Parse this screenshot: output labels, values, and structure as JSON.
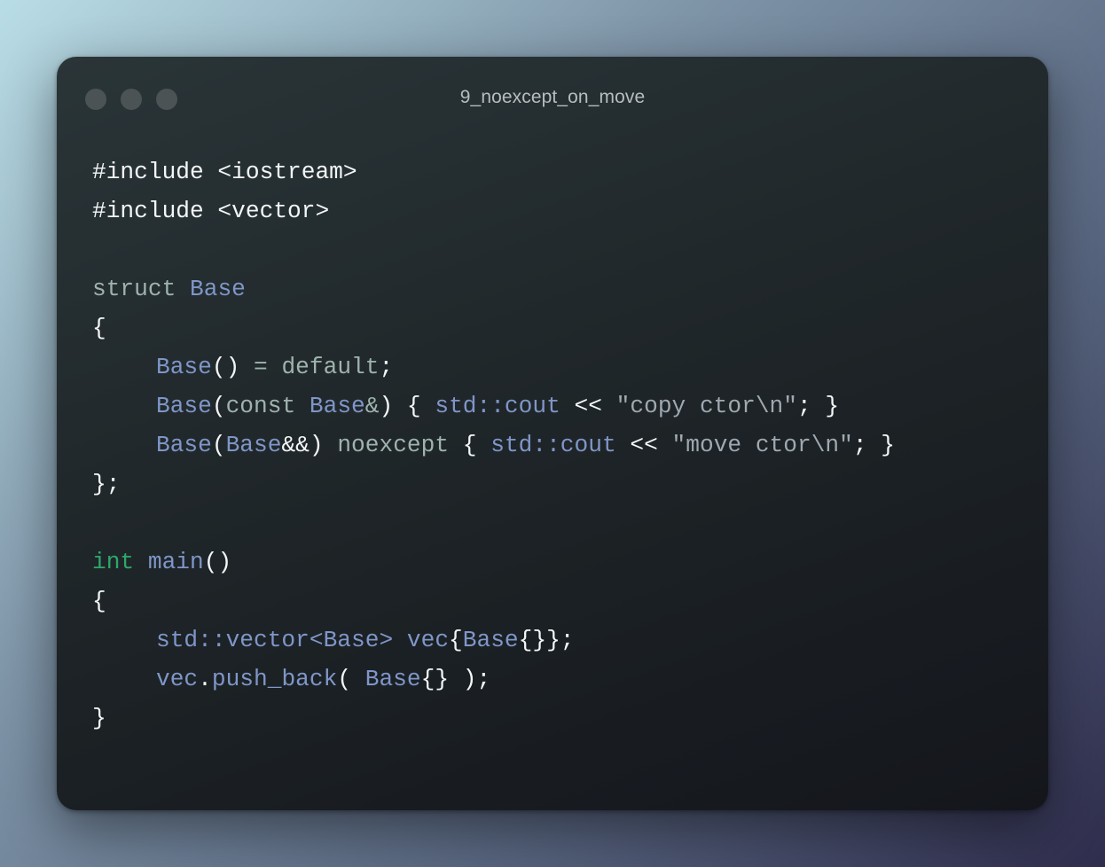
{
  "window": {
    "title": "9_noexcept_on_move",
    "controls": [
      "close",
      "minimize",
      "maximize"
    ]
  },
  "colors": {
    "plain": "#f3f6f6",
    "keyword": "#9fb3ad",
    "type_keyword": "#2da86a",
    "identifier": "#7f96c8",
    "string": "#9ea9b1",
    "window_control": "#4c5354",
    "title_text": "#b7bcbf"
  },
  "code": {
    "lines": [
      {
        "indent": 0,
        "tokens": [
          {
            "t": "plain",
            "s": "#include <iostream>"
          }
        ]
      },
      {
        "indent": 0,
        "tokens": [
          {
            "t": "plain",
            "s": "#include <vector>"
          }
        ]
      },
      {
        "indent": 0,
        "tokens": []
      },
      {
        "indent": 0,
        "tokens": [
          {
            "t": "kw",
            "s": "struct "
          },
          {
            "t": "ident",
            "s": "Base"
          }
        ]
      },
      {
        "indent": 0,
        "tokens": [
          {
            "t": "plain",
            "s": "{"
          }
        ]
      },
      {
        "indent": 1,
        "tokens": [
          {
            "t": "ident",
            "s": "Base"
          },
          {
            "t": "plain",
            "s": "() "
          },
          {
            "t": "kw",
            "s": "= default"
          },
          {
            "t": "plain",
            "s": ";"
          }
        ]
      },
      {
        "indent": 1,
        "tokens": [
          {
            "t": "ident",
            "s": "Base"
          },
          {
            "t": "plain",
            "s": "("
          },
          {
            "t": "kw",
            "s": "const "
          },
          {
            "t": "ident",
            "s": "Base"
          },
          {
            "t": "kw",
            "s": "&"
          },
          {
            "t": "plain",
            "s": ") { "
          },
          {
            "t": "ident",
            "s": "std::cout"
          },
          {
            "t": "plain",
            "s": " << "
          },
          {
            "t": "str",
            "s": "\"copy ctor\\n\""
          },
          {
            "t": "plain",
            "s": "; }"
          }
        ]
      },
      {
        "indent": 1,
        "tokens": [
          {
            "t": "ident",
            "s": "Base"
          },
          {
            "t": "plain",
            "s": "("
          },
          {
            "t": "ident",
            "s": "Base"
          },
          {
            "t": "plain",
            "s": "&&) "
          },
          {
            "t": "kw",
            "s": "noexcept"
          },
          {
            "t": "plain",
            "s": " { "
          },
          {
            "t": "ident",
            "s": "std::cout"
          },
          {
            "t": "plain",
            "s": " << "
          },
          {
            "t": "str",
            "s": "\"move ctor\\n\""
          },
          {
            "t": "plain",
            "s": "; }"
          }
        ]
      },
      {
        "indent": 0,
        "tokens": [
          {
            "t": "plain",
            "s": "};"
          }
        ]
      },
      {
        "indent": 0,
        "tokens": []
      },
      {
        "indent": 0,
        "tokens": [
          {
            "t": "type",
            "s": "int"
          },
          {
            "t": "plain",
            "s": " "
          },
          {
            "t": "ident",
            "s": "main"
          },
          {
            "t": "plain",
            "s": "()"
          }
        ]
      },
      {
        "indent": 0,
        "tokens": [
          {
            "t": "plain",
            "s": "{"
          }
        ]
      },
      {
        "indent": 1,
        "tokens": [
          {
            "t": "ident",
            "s": "std::vector"
          },
          {
            "t": "ident",
            "s": "<Base>"
          },
          {
            "t": "plain",
            "s": " "
          },
          {
            "t": "ident",
            "s": "vec"
          },
          {
            "t": "plain",
            "s": "{"
          },
          {
            "t": "ident",
            "s": "Base"
          },
          {
            "t": "plain",
            "s": "{}};"
          }
        ]
      },
      {
        "indent": 1,
        "tokens": [
          {
            "t": "ident",
            "s": "vec"
          },
          {
            "t": "plain",
            "s": "."
          },
          {
            "t": "ident",
            "s": "push_back"
          },
          {
            "t": "plain",
            "s": "( "
          },
          {
            "t": "ident",
            "s": "Base"
          },
          {
            "t": "plain",
            "s": "{} );"
          }
        ]
      },
      {
        "indent": 0,
        "tokens": [
          {
            "t": "plain",
            "s": "}"
          }
        ]
      }
    ]
  }
}
